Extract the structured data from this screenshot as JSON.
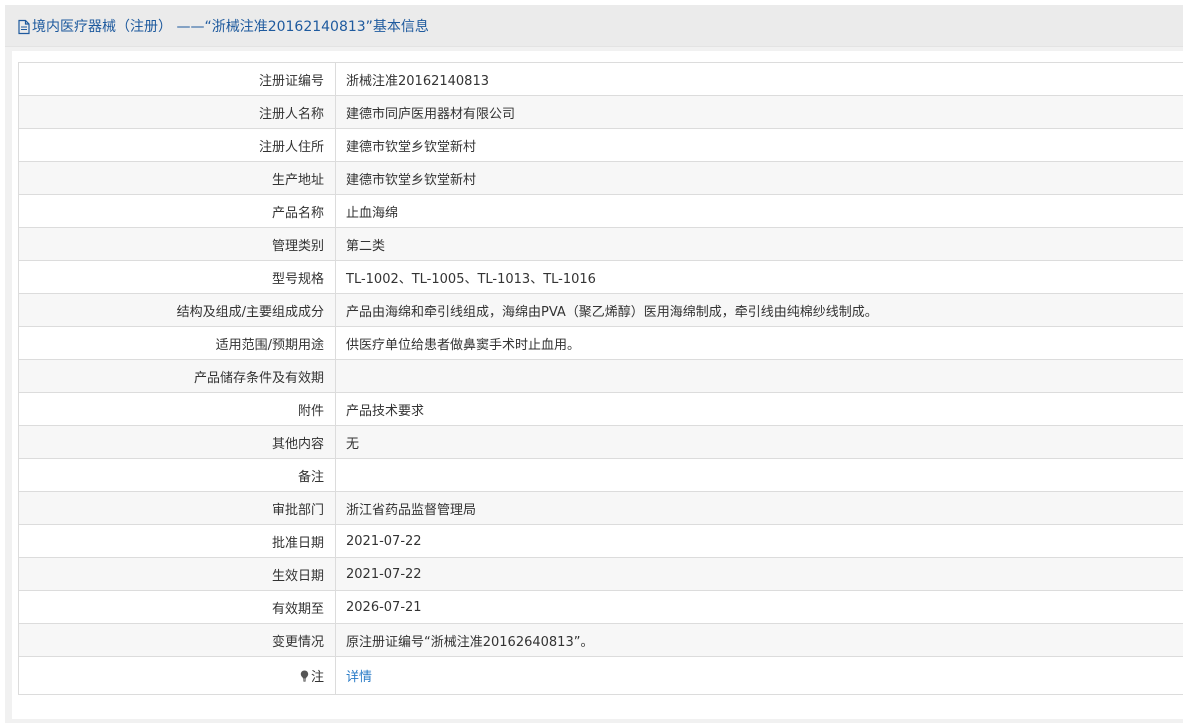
{
  "header": {
    "icon": "document-icon",
    "title": "境内医疗器械（注册）  ——“浙械注准20162140813”基本信息"
  },
  "rows": [
    {
      "label": "注册证编号",
      "value": "浙械注准20162140813"
    },
    {
      "label": "注册人名称",
      "value": "建德市同庐医用器材有限公司"
    },
    {
      "label": "注册人住所",
      "value": "建德市钦堂乡钦堂新村"
    },
    {
      "label": "生产地址",
      "value": "建德市钦堂乡钦堂新村"
    },
    {
      "label": "产品名称",
      "value": "止血海绵"
    },
    {
      "label": "管理类别",
      "value": "第二类"
    },
    {
      "label": "型号规格",
      "value": "TL-1002、TL-1005、TL-1013、TL-1016"
    },
    {
      "label": "结构及组成/主要组成成分",
      "value": "产品由海绵和牵引线组成，海绵由PVA（聚乙烯醇）医用海绵制成，牵引线由纯棉纱线制成。"
    },
    {
      "label": "适用范围/预期用途",
      "value": "供医疗单位给患者做鼻窦手术时止血用。"
    },
    {
      "label": "产品储存条件及有效期",
      "value": ""
    },
    {
      "label": "附件",
      "value": "产品技术要求"
    },
    {
      "label": "其他内容",
      "value": "无"
    },
    {
      "label": "备注",
      "value": ""
    },
    {
      "label": "审批部门",
      "value": "浙江省药品监督管理局"
    },
    {
      "label": "批准日期",
      "value": "2021-07-22"
    },
    {
      "label": "生效日期",
      "value": "2021-07-22"
    },
    {
      "label": "有效期至",
      "value": "2026-07-21"
    },
    {
      "label": "变更情况",
      "value": "原注册证编号“浙械注准20162640813”。"
    }
  ],
  "note": {
    "icon": "lightbulb-icon",
    "label": "注",
    "link_text": "详情"
  },
  "colors": {
    "title": "#1e5a9e",
    "link": "#2a7cc7",
    "border": "#dcdcdc"
  }
}
